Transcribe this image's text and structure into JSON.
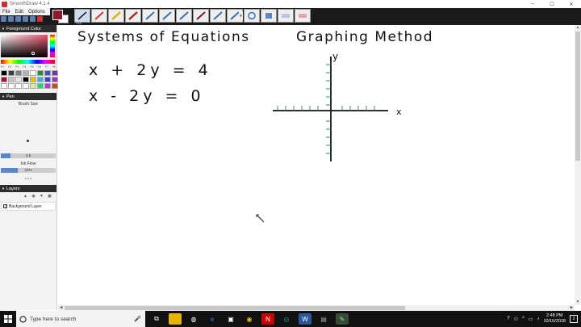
{
  "window": {
    "title": "SmoothDraw 4.1.4",
    "minimize": "–",
    "maximize": "☐",
    "close": "✕"
  },
  "menu": {
    "items": [
      "File",
      "Edit",
      "Options"
    ]
  },
  "toolbar": {
    "active_tool_label": "Pen",
    "expand_glyph": "▾",
    "foreground_color": "#8b1a2e",
    "background_color": "#ffffff"
  },
  "panel": {
    "foreground_color_header": "Foreground Color",
    "fkeys": [
      "F1",
      "F2",
      "F3",
      "F4",
      "F5",
      "F6",
      "F7",
      "F8"
    ],
    "palette": [
      "#000000",
      "#3a3a3a",
      "#7f7f7f",
      "#b5b5b5",
      "#ffffff",
      "#1f8f3a",
      "#2f56c8",
      "#7a2fb0",
      "#b8002e",
      "#c8c8c8",
      "#e8e8e8",
      "#000000",
      "#e8c000",
      "#3ab0e0",
      "#3a3ad8",
      "#9a3ab8",
      "#ffffff",
      "#ffffff",
      "#ffffff",
      "#ffffff",
      "#d8e8a0",
      "#30d070",
      "#b040d0",
      "#c05020"
    ],
    "pen_header": "Pen",
    "brush_size_label": "Brush Size",
    "brush_size_value": "4.6",
    "brush_size_fraction": 0.17,
    "ink_flow_label": "Ink Flow",
    "ink_flow_value": "31%",
    "ink_flow_fraction": 0.31,
    "more": "• • •",
    "layers_header": "Layers",
    "layer_name": "Background Layer",
    "layer_checked": "✓"
  },
  "canvas": {
    "title_left": "Systems of Equations",
    "title_right": "Graphing Method",
    "equation_1": "x + 2y = 4",
    "equation_2": "x - 2y = 0",
    "axis_y_label": "y",
    "axis_x_label": "x"
  },
  "taskbar": {
    "search_placeholder": "Type here to search",
    "time": "2:48 PM",
    "date": "10/15/2018",
    "notifications": "2"
  }
}
